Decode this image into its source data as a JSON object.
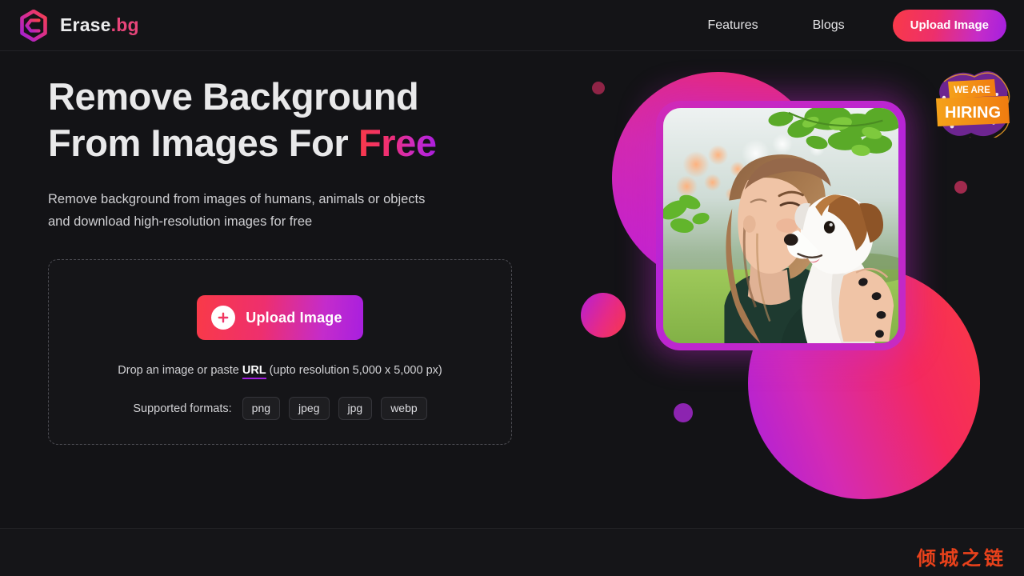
{
  "header": {
    "brand_name": "Erase",
    "brand_suffix": ".bg",
    "logo_icon": "erase-bg-logo-icon",
    "nav": [
      {
        "label": "Features"
      },
      {
        "label": "Blogs"
      }
    ],
    "upload_button_label": "Upload Image"
  },
  "hero": {
    "headline_line1": "Remove Background",
    "headline_line2_prefix": "From Images For ",
    "headline_highlight": "Free",
    "subheadline_line1": "Remove background from images of humans, animals or objects",
    "subheadline_line2": "and download high-resolution images for free"
  },
  "dropzone": {
    "upload_button_label": "Upload Image",
    "plus_icon": "plus-icon",
    "hint_prefix": "Drop an image or paste ",
    "hint_link": "URL",
    "hint_suffix": " (upto resolution 5,000 x 5,000 px)",
    "formats_label": "Supported formats:",
    "formats": [
      "png",
      "jpeg",
      "jpg",
      "webp"
    ]
  },
  "art": {
    "photo_alt": "girl-kissing-dog-photo",
    "hiring_badge": {
      "line1": "WE ARE",
      "line2": "HIRING"
    }
  },
  "footer": {
    "watermark": "倾城之链"
  },
  "colors": {
    "page_background": "#131316",
    "header_background": "#141417",
    "accent_red": "#f93a48",
    "accent_pink": "#ee2f6e",
    "accent_magenta": "#c42ccb",
    "accent_purple": "#a81fdf",
    "text_primary": "#e9e9ea",
    "text_secondary": "#cfcfd2",
    "watermark_color": "#e8411b",
    "badge_purple": "#6d2590",
    "badge_orange": "#f59312"
  }
}
